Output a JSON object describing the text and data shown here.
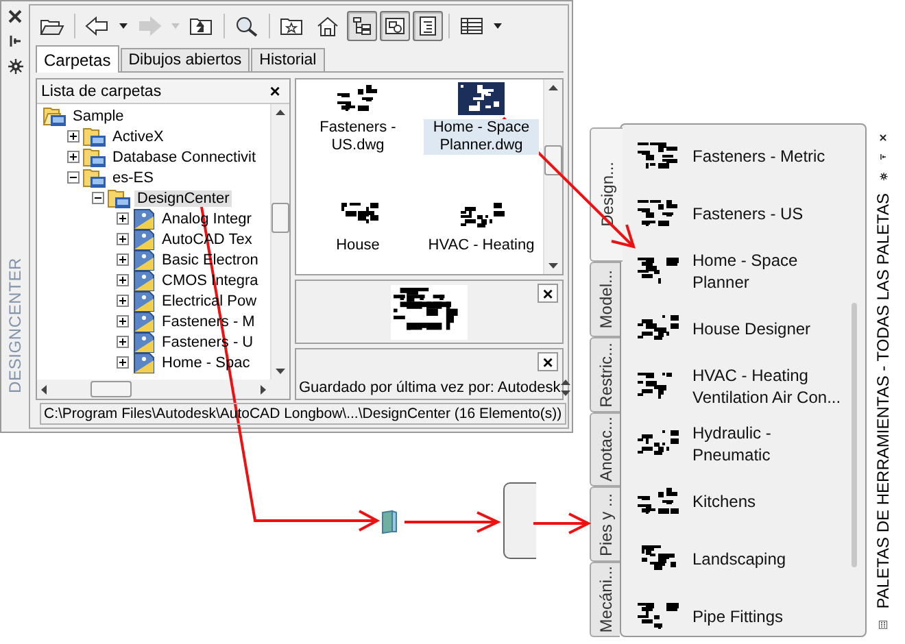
{
  "designcenter": {
    "title": "DESIGNCENTER",
    "toolbar": [
      {
        "kind": "load",
        "on": false,
        "disabled": false
      },
      {
        "kind": "back",
        "on": false,
        "disabled": false
      },
      {
        "kind": "menu",
        "on": false,
        "disabled": false
      },
      {
        "kind": "forward",
        "on": false,
        "disabled": true
      },
      {
        "kind": "menu",
        "on": false,
        "disabled": true
      },
      {
        "kind": "up",
        "on": false,
        "disabled": false
      },
      {
        "kind": "search",
        "on": false,
        "disabled": false
      },
      {
        "kind": "favorites",
        "on": false,
        "disabled": false
      },
      {
        "kind": "home",
        "on": false,
        "disabled": false
      },
      {
        "kind": "tree",
        "on": true,
        "disabled": false
      },
      {
        "kind": "preview",
        "on": true,
        "disabled": false
      },
      {
        "kind": "description",
        "on": true,
        "disabled": false
      },
      {
        "kind": "views",
        "on": false,
        "disabled": false
      },
      {
        "kind": "menu",
        "on": false,
        "disabled": false
      }
    ],
    "tabs": [
      {
        "label": "Carpetas",
        "selected": true
      },
      {
        "label": "Dibujos abiertos",
        "selected": false
      },
      {
        "label": "Historial",
        "selected": false
      }
    ],
    "folder_list": {
      "title": "Lista de carpetas",
      "close": "×",
      "tree": [
        {
          "label": "Sample",
          "kind": "folder",
          "expanded": true,
          "selected": false,
          "children": [
            {
              "label": "ActiveX",
              "kind": "folder",
              "expanded": false,
              "selected": false
            },
            {
              "label": "Database Connectivit",
              "kind": "folder",
              "expanded": false,
              "selected": false
            },
            {
              "label": "es-ES",
              "kind": "folder",
              "expanded": true,
              "selected": false,
              "children": [
                {
                  "label": "DesignCenter",
                  "kind": "folder",
                  "expanded": true,
                  "selected": true,
                  "children": [
                    {
                      "label": "Analog Integr",
                      "kind": "drawing",
                      "expanded": false,
                      "selected": false
                    },
                    {
                      "label": "AutoCAD Tex",
                      "kind": "drawing",
                      "expanded": false,
                      "selected": false
                    },
                    {
                      "label": "Basic Electron",
                      "kind": "drawing",
                      "expanded": false,
                      "selected": false
                    },
                    {
                      "label": "CMOS Integra",
                      "kind": "drawing",
                      "expanded": false,
                      "selected": false
                    },
                    {
                      "label": "Electrical Pow",
                      "kind": "drawing",
                      "expanded": false,
                      "selected": false
                    },
                    {
                      "label": "Fasteners - M",
                      "kind": "drawing",
                      "expanded": false,
                      "selected": false
                    },
                    {
                      "label": "Fasteners - U",
                      "kind": "drawing",
                      "expanded": false,
                      "selected": false
                    },
                    {
                      "label": "Home - Spac",
                      "kind": "drawing",
                      "expanded": false,
                      "selected": false
                    }
                  ]
                }
              ]
            }
          ]
        }
      ]
    },
    "files": [
      {
        "label": "Fasteners - US.dwg",
        "selected": false
      },
      {
        "label": "Home - Space Planner.dwg",
        "selected": true
      },
      {
        "label": "House",
        "selected": false
      },
      {
        "label": "HVAC - Heating",
        "selected": false
      }
    ],
    "preview_close": "×",
    "description_close": "×",
    "description": "Guardado por última vez por: Autodesk",
    "status": "C:\\Program Files\\Autodesk\\AutoCAD Longbow\\...\\DesignCenter (16 Elemento(s))"
  },
  "tool_palette": {
    "title": "PALETAS DE HERRAMIENTAS - TODAS LAS PALETAS",
    "tabs": [
      {
        "label": "Design...",
        "selected": true
      },
      {
        "label": "Model...",
        "selected": false
      },
      {
        "label": "Restric...",
        "selected": false
      },
      {
        "label": "Anotac...",
        "selected": false
      },
      {
        "label": "Pies y ...",
        "selected": false
      },
      {
        "label": "Mecáni...",
        "selected": false
      }
    ],
    "items": [
      {
        "label": "Fasteners - Metric"
      },
      {
        "label": "Fasteners - US"
      },
      {
        "label": "Home - Space\nPlanner"
      },
      {
        "label": "House Designer"
      },
      {
        "label": "HVAC - Heating\nVentilation  Air Con..."
      },
      {
        "label": "Hydraulic -\nPneumatic"
      },
      {
        "label": "Kitchens"
      },
      {
        "label": "Landscaping"
      },
      {
        "label": "Pipe Fittings"
      }
    ]
  }
}
